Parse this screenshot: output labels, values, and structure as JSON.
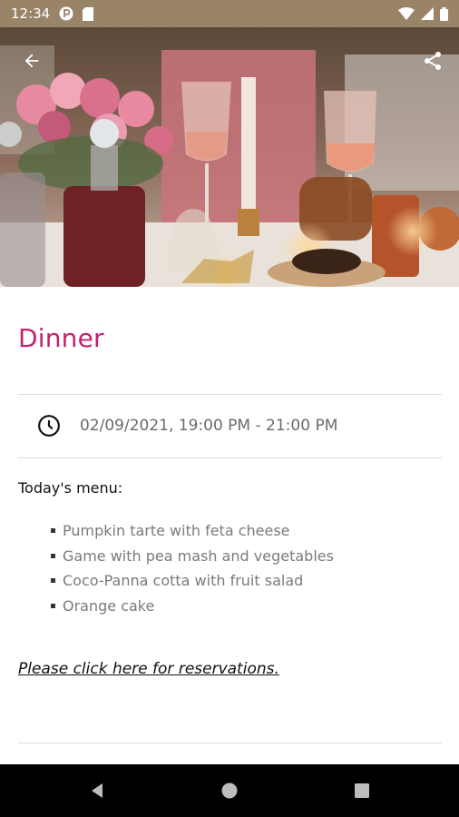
{
  "status_bar": {
    "time": "12:34",
    "background": "#9a8468"
  },
  "hero": {
    "image_description_icon": "dinner-table-photo",
    "back_icon": "arrow-left-icon",
    "share_icon": "share-icon"
  },
  "event": {
    "title": "Dinner",
    "title_color": "#c2226e",
    "datetime": "02/09/2021, 19:00 PM - 21:00 PM",
    "menu_heading": "Today's menu:",
    "menu_items": [
      "Pumpkin tarte with feta cheese",
      "Game with pea mash and vegetables",
      "Coco-Panna cotta with fruit salad",
      "Orange cake"
    ],
    "reservation_link": "Please click here for reservations."
  },
  "nav_bar": {
    "back_icon": "nav-back-icon",
    "home_icon": "nav-home-icon",
    "recents_icon": "nav-recents-icon"
  }
}
